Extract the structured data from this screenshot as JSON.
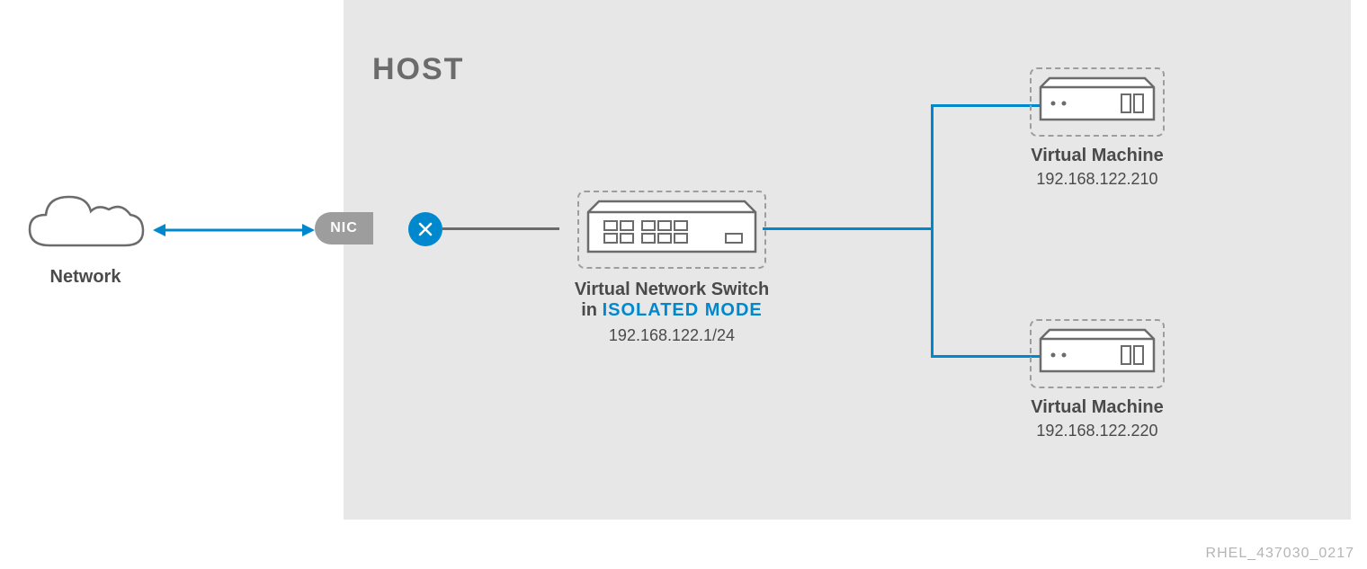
{
  "network": {
    "label": "Network"
  },
  "nic": {
    "label": "NIC"
  },
  "host": {
    "label": "HOST"
  },
  "switch": {
    "title": "Virtual Network Switch",
    "mode_prefix": "in ",
    "mode_name": "ISOLATED MODE",
    "ip": "192.168.122.1/24"
  },
  "vm1": {
    "label": "Virtual Machine",
    "ip": "192.168.122.210"
  },
  "vm2": {
    "label": "Virtual Machine",
    "ip": "192.168.122.220"
  },
  "ref": "RHEL_437030_0217"
}
